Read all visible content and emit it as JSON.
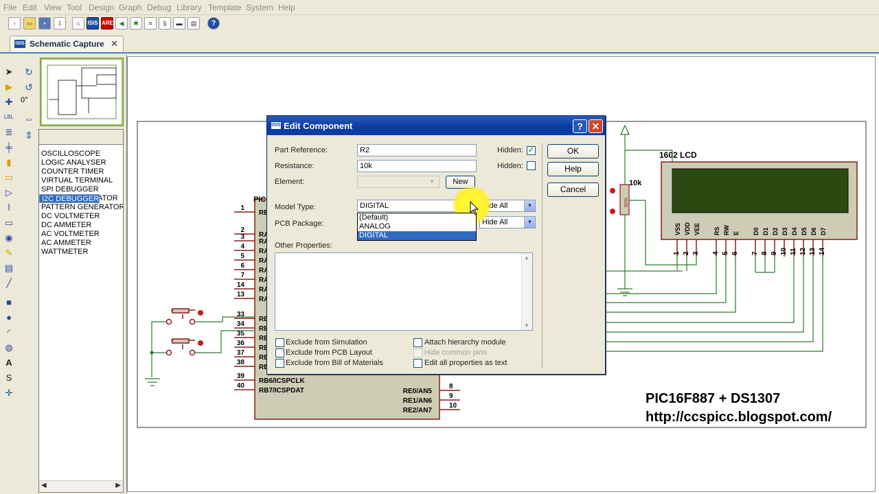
{
  "menu": [
    "File",
    "Edit",
    "View",
    "Tool",
    "Design",
    "Graph",
    "Debug",
    "Library",
    "Template",
    "System",
    "Help"
  ],
  "tab": {
    "label": "Schematic Capture",
    "close": "✕",
    "icon_text": "ISIS"
  },
  "toolbar_icons": [
    "new-icon",
    "open-icon",
    "save-icon",
    "import-icon",
    "home-icon",
    "isis-icon",
    "ares-icon",
    "back-icon",
    "component-icon",
    "bom-icon",
    "script-icon",
    "netlist-icon",
    "doc-icon",
    "help-icon"
  ],
  "toolbar_text": {
    "isis": "ISIS",
    "ares": "ARES",
    "help": "?"
  },
  "rotation": {
    "angle": "0°"
  },
  "device_list": {
    "items": [
      "OSCILLOSCOPE",
      "LOGIC ANALYSER",
      "COUNTER TIMER",
      "VIRTUAL TERMINAL",
      "SPI DEBUGGER",
      "I2C DEBUGGER",
      "SIGNAL GENERATOR",
      "PATTERN GENERATOR",
      "DC VOLTMETER",
      "DC AMMETER",
      "AC VOLTMETER",
      "AC AMMETER",
      "WATTMETER"
    ],
    "selected": "I2C DEBUGGER"
  },
  "schematic": {
    "pic_label": "PIC",
    "left_pins": [
      "1",
      "2",
      "3",
      "4",
      "5",
      "6",
      "7",
      "14",
      "13",
      "33",
      "34",
      "35",
      "36",
      "37",
      "38",
      "39",
      "40"
    ],
    "left_pin_names": [
      "RE",
      "RA",
      "RA",
      "RA",
      "RA",
      "RA",
      "RA",
      "RA",
      "RA",
      "RB",
      "RB",
      "RB",
      "RB",
      "RB",
      "RB",
      "RB6/ICSPCLK",
      "RB7/ICSPDAT"
    ],
    "right_pins": [
      "8",
      "9",
      "10"
    ],
    "right_pin_names": [
      "RE0/AN5",
      "RE1/AN6",
      "RE2/AN7"
    ],
    "lcd_label": "1602 LCD",
    "lcd_pin_names": [
      "VSS",
      "VDD",
      "VEE",
      "RS",
      "RW",
      "E",
      "D0",
      "D1",
      "D2",
      "D3",
      "D4",
      "D5",
      "D6",
      "D7"
    ],
    "lcd_pin_numbers": [
      "1",
      "2",
      "3",
      "4",
      "5",
      "6",
      "7",
      "8",
      "9",
      "10",
      "11",
      "12",
      "13",
      "14"
    ],
    "pot_value": "10k",
    "pot_body": "50%",
    "watermark_line1": "PIC16F887 + DS1307",
    "watermark_line2": "http://ccspicc.blogspot.com/"
  },
  "dialog": {
    "title": "Edit Component",
    "help_caption": "?",
    "close_caption": "✕",
    "part_reference_label": "Part Reference:",
    "part_reference_value": "R2",
    "resistance_label": "Resistance:",
    "resistance_value": "10k",
    "element_label": "Element:",
    "element_value": "",
    "new_button": "New",
    "hidden_label_1": "Hidden:",
    "hidden_label_2": "Hidden:",
    "hidden_1_checked": true,
    "hidden_2_checked": false,
    "model_type_label": "Model Type:",
    "model_type_value": "DIGITAL",
    "model_type_options": [
      "(Default)",
      "ANALOG",
      "DIGITAL"
    ],
    "pcb_package_label": "PCB Package:",
    "hide_all_1": "Hide All",
    "hide_all_2": "Hide All",
    "other_properties_label": "Other Properties:",
    "ok_button": "OK",
    "help_button": "Help",
    "cancel_button": "Cancel",
    "checkboxes_left": [
      "Exclude from Simulation",
      "Exclude from PCB Layout",
      "Exclude from Bill of Materials"
    ],
    "checkboxes_right": [
      "Attach hierarchy module",
      "Hide common pins",
      "Edit all properties as text"
    ]
  },
  "colors": {
    "selection": "#316ac5",
    "titlebar": "#0a3aa2",
    "wire": "#2a7a2a",
    "pin": "#8b1a1a"
  }
}
